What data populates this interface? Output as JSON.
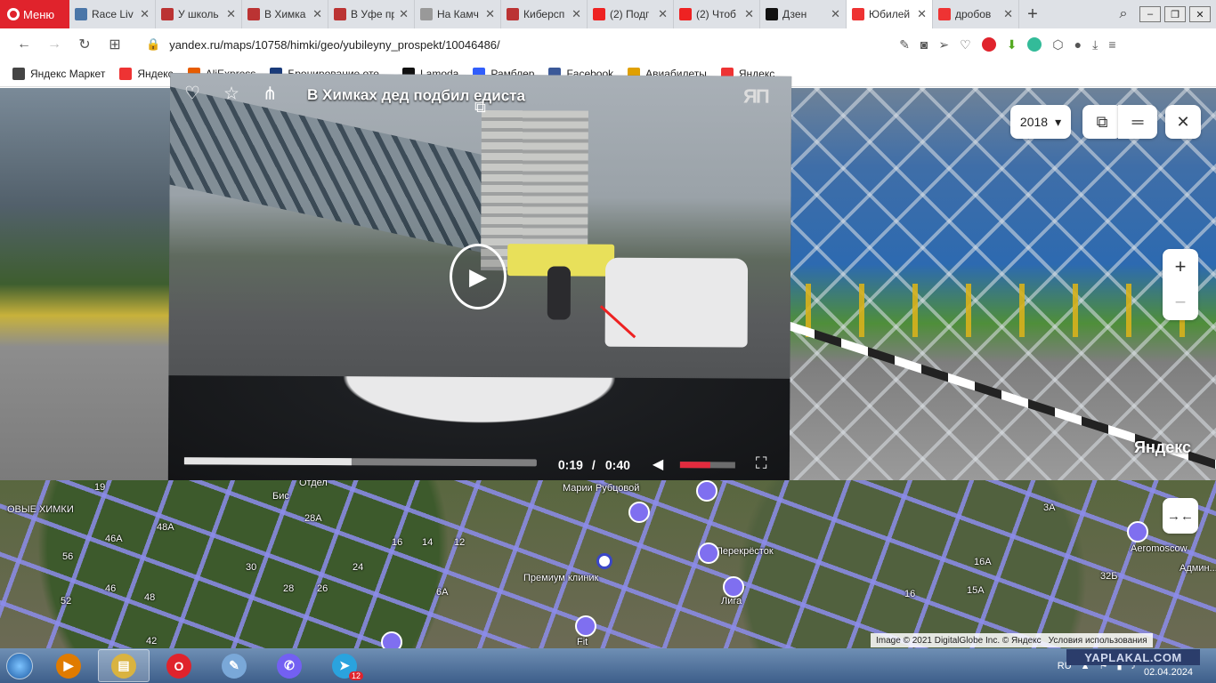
{
  "browser": {
    "menu_label": "Меню",
    "tabs": [
      {
        "title": "Race Liv",
        "favicon": "vk",
        "color": "#4a76a8"
      },
      {
        "title": "У школь",
        "favicon": "yaplakal",
        "color": "#b33"
      },
      {
        "title": "В Химка",
        "favicon": "yaplakal",
        "color": "#b33"
      },
      {
        "title": "В Уфе пр",
        "favicon": "yaplakal",
        "color": "#b33"
      },
      {
        "title": "На Камч",
        "favicon": "loading",
        "color": "#999"
      },
      {
        "title": "Киберсп",
        "favicon": "yaplakal",
        "color": "#b33"
      },
      {
        "title": "(2) Подг",
        "favicon": "youtube",
        "color": "#e22"
      },
      {
        "title": "(2) Чтоб",
        "favicon": "youtube",
        "color": "#e22"
      },
      {
        "title": "Дзен",
        "favicon": "dzen",
        "color": "#111"
      },
      {
        "title": "Юбилей",
        "favicon": "yandex-maps",
        "color": "#e33",
        "active": true
      },
      {
        "title": "дробов",
        "favicon": "yandex",
        "color": "#e33"
      }
    ],
    "new_tab": "+",
    "url": "yandex.ru/maps/10758/himki/geo/yubileyny_prospekt/10046486/",
    "bookmarks": [
      {
        "label": "Яндекс Маркет",
        "icon": "page-icon",
        "color": "#444"
      },
      {
        "label": "Яндекс",
        "icon": "yandex-icon",
        "color": "#e33"
      },
      {
        "label": "AliExpress",
        "icon": "aliexpress-icon",
        "color": "#e65c00"
      },
      {
        "label": "Бронирование оте...",
        "icon": "booking-icon",
        "color": "#1a3b7a"
      },
      {
        "label": "Lamoda",
        "icon": "lamoda-icon",
        "color": "#111"
      },
      {
        "label": "Рамблер",
        "icon": "rambler-icon",
        "color": "#315efb"
      },
      {
        "label": "Facebook",
        "icon": "facebook-icon",
        "color": "#3b5998"
      },
      {
        "label": "Авиабилеты",
        "icon": "aviasales-icon",
        "color": "#e0a000"
      },
      {
        "label": "Яндекс",
        "icon": "yandex-icon",
        "color": "#e33"
      }
    ]
  },
  "panorama": {
    "year": "2018",
    "watermark": "Яндекс"
  },
  "video": {
    "title": "В Химках дед подбил мотоциклиста",
    "title_visible": "В Химках дед подбил     едиста",
    "channel_logo": "ЯП",
    "current_time": "0:19",
    "separator": "/",
    "duration": "0:40",
    "progress": 0.475,
    "volume": 0.55
  },
  "map": {
    "labels": [
      {
        "text": "ОВЫЕ ХИМКИ"
      },
      {
        "text": "46А"
      },
      {
        "text": "48А"
      },
      {
        "text": "56"
      },
      {
        "text": "46"
      },
      {
        "text": "52"
      },
      {
        "text": "48"
      },
      {
        "text": "42"
      },
      {
        "text": "28А"
      },
      {
        "text": "30"
      },
      {
        "text": "28"
      },
      {
        "text": "26"
      },
      {
        "text": "24"
      },
      {
        "text": "16"
      },
      {
        "text": "14"
      },
      {
        "text": "12"
      },
      {
        "text": "6А"
      },
      {
        "text": "Марии Рубцовой"
      },
      {
        "text": "Перекрёсток"
      },
      {
        "text": "Премиум клиник"
      },
      {
        "text": "Лига"
      },
      {
        "text": "16А"
      },
      {
        "text": "15А"
      },
      {
        "text": "16"
      },
      {
        "text": "3А"
      },
      {
        "text": "Aeromoscow"
      },
      {
        "text": "Админ..."
      },
      {
        "text": "Fit"
      },
      {
        "text": "19"
      },
      {
        "text": "32Б"
      },
      {
        "text": "Отдел"
      },
      {
        "text": "Бис"
      }
    ],
    "copyright": "Image © 2021 DigitalGlobe Inc. © Яндекс",
    "terms": "Условия использования"
  },
  "taskbar": {
    "apps": [
      {
        "name": "media-player",
        "color": "#e07b00",
        "glyph": "▶"
      },
      {
        "name": "file-explorer",
        "color": "#d9b340",
        "glyph": "▤",
        "open": true
      },
      {
        "name": "opera",
        "color": "#e0232c",
        "glyph": "O"
      },
      {
        "name": "paint",
        "color": "#7aa8d8",
        "glyph": "✎"
      },
      {
        "name": "viber",
        "color": "#7360f2",
        "glyph": "✆"
      },
      {
        "name": "telegram",
        "color": "#2aa3de",
        "glyph": "➤",
        "badge": "12"
      }
    ],
    "lang": "RU",
    "watermark": "YAPLAKAL.COM",
    "date": "02.04.2024"
  }
}
